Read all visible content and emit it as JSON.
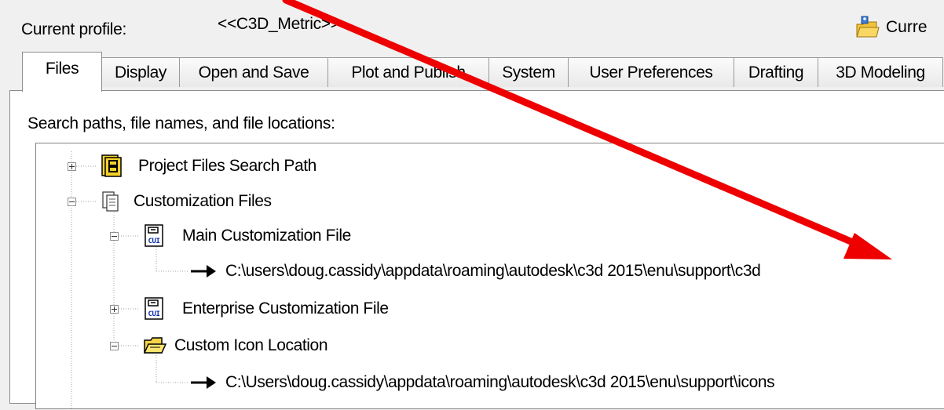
{
  "profile": {
    "label": "Current profile:",
    "value": "<<C3D_Metric>>",
    "current_button": {
      "label": "Curre",
      "icon": "profile-folder-icon"
    }
  },
  "tabs": [
    {
      "label": "Files",
      "active": true
    },
    {
      "label": "Display"
    },
    {
      "label": "Open and Save"
    },
    {
      "label": "Plot and Publish"
    },
    {
      "label": "System"
    },
    {
      "label": "User Preferences"
    },
    {
      "label": "Drafting"
    },
    {
      "label": "3D Modeling"
    }
  ],
  "panel": {
    "caption": "Search paths, file names, and file locations:"
  },
  "tree": [
    {
      "label": "Project Files Search Path",
      "icon": "project-files-icon",
      "expander": "plus"
    },
    {
      "label": "Customization Files",
      "icon": "customization-files-icon",
      "expander": "minus"
    },
    {
      "label": "Main Customization File",
      "icon": "cui-file-icon",
      "expander": "minus"
    },
    {
      "label": "C:\\users\\doug.cassidy\\appdata\\roaming\\autodesk\\c3d 2015\\enu\\support\\c3d",
      "icon": "path-arrow-icon"
    },
    {
      "label": "Enterprise Customization File",
      "icon": "cui-file-icon",
      "expander": "plus"
    },
    {
      "label": "Custom Icon Location",
      "icon": "open-folder-icon",
      "expander": "minus"
    },
    {
      "label": "C:\\Users\\doug.cassidy\\appdata\\roaming\\autodesk\\c3d 2015\\enu\\support\\icons",
      "icon": "path-arrow-icon"
    }
  ],
  "colors": {
    "annotation_arrow": "#ee0000",
    "tree_lines": "#a0a0a0",
    "panel_bg": "#ffffff",
    "window_bg": "#f0f0f0"
  }
}
